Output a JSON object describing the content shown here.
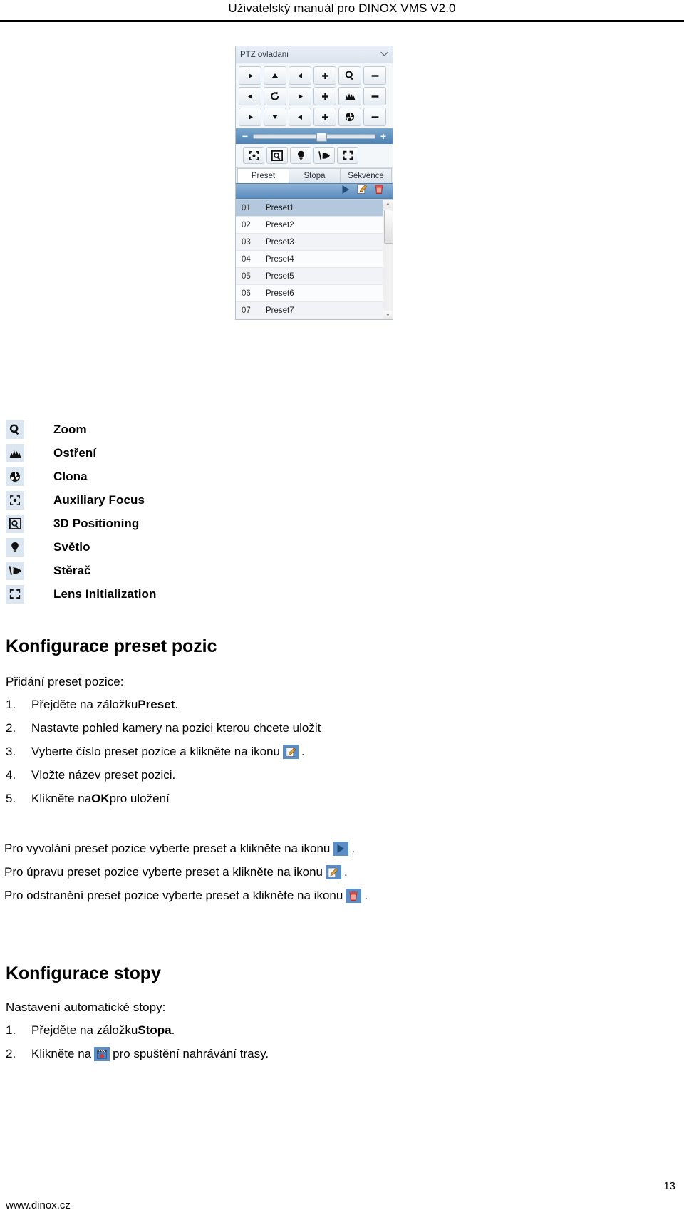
{
  "header": {
    "running_title": "Uživatelský manuál pro DINOX VMS V2.0"
  },
  "ptz_panel": {
    "title": "PTZ ovladani",
    "collapse_icon": "chevron-down-icon",
    "direction_rows": [
      {
        "buttons": [
          {
            "icon": "arrow-up-left-icon",
            "glyph": "▸"
          },
          {
            "icon": "arrow-up-icon",
            "glyph": "▲"
          },
          {
            "icon": "arrow-up-right-icon",
            "glyph": "◂"
          },
          {
            "icon": "zoom-plus-icon",
            "glyph": "+"
          },
          {
            "icon": "zoom-icon",
            "glyph": "zoom"
          },
          {
            "icon": "zoom-minus-icon",
            "glyph": "−"
          }
        ]
      },
      {
        "buttons": [
          {
            "icon": "arrow-left-icon",
            "glyph": "◀"
          },
          {
            "icon": "auto-scan-icon",
            "glyph": "↻"
          },
          {
            "icon": "arrow-right-icon",
            "glyph": "▶"
          },
          {
            "icon": "focus-plus-icon",
            "glyph": "+"
          },
          {
            "icon": "focus-icon",
            "glyph": "focus"
          },
          {
            "icon": "focus-minus-icon",
            "glyph": "−"
          }
        ]
      },
      {
        "buttons": [
          {
            "icon": "arrow-down-left-icon",
            "glyph": "▸"
          },
          {
            "icon": "arrow-down-icon",
            "glyph": "▼"
          },
          {
            "icon": "arrow-down-right-icon",
            "glyph": "◂"
          },
          {
            "icon": "iris-plus-icon",
            "glyph": "+"
          },
          {
            "icon": "iris-icon",
            "glyph": "iris"
          },
          {
            "icon": "iris-minus-icon",
            "glyph": "−"
          }
        ]
      }
    ],
    "speed_slider": {
      "minus_label": "−",
      "plus_label": "+",
      "value_percent": 52
    },
    "tools": [
      {
        "icon": "auxiliary-focus-icon"
      },
      {
        "icon": "3d-positioning-icon"
      },
      {
        "icon": "light-icon"
      },
      {
        "icon": "wiper-icon"
      },
      {
        "icon": "lens-initialization-icon"
      }
    ],
    "tabs": [
      {
        "label": "Preset",
        "active": true
      },
      {
        "label": "Stopa",
        "active": false
      },
      {
        "label": "Sekvence",
        "active": false
      }
    ],
    "action_bar": [
      {
        "icon": "play-icon"
      },
      {
        "icon": "edit-pencil-icon"
      },
      {
        "icon": "delete-trash-icon"
      }
    ],
    "presets": [
      {
        "index": "01",
        "name": "Preset1",
        "selected": true
      },
      {
        "index": "02",
        "name": "Preset2",
        "selected": false
      },
      {
        "index": "03",
        "name": "Preset3",
        "selected": false
      },
      {
        "index": "04",
        "name": "Preset4",
        "selected": false
      },
      {
        "index": "05",
        "name": "Preset5",
        "selected": false
      },
      {
        "index": "06",
        "name": "Preset6",
        "selected": false
      },
      {
        "index": "07",
        "name": "Preset7",
        "selected": false
      }
    ],
    "scrollbar": {
      "up_arrow": "▲",
      "down_arrow": "▼"
    }
  },
  "legend": [
    {
      "icon": "zoom-icon",
      "label": "Zoom"
    },
    {
      "icon": "focus-icon",
      "label": "Ostření"
    },
    {
      "icon": "iris-icon",
      "label": "Clona"
    },
    {
      "icon": "auxiliary-focus-icon",
      "label": "Auxiliary Focus"
    },
    {
      "icon": "3d-positioning-icon",
      "label": "3D Positioning"
    },
    {
      "icon": "light-icon",
      "label": "Světlo"
    },
    {
      "icon": "wiper-icon",
      "label": "Stěrač"
    },
    {
      "icon": "lens-initialization-icon",
      "label": "Lens Initialization"
    }
  ],
  "sections": {
    "presets": {
      "heading": "Konfigurace preset pozic",
      "intro": "Přidání preset pozice:",
      "steps": [
        {
          "num": "1.",
          "pre": "Přejděte na záložku ",
          "bold": "Preset",
          "post": ".",
          "icon": null
        },
        {
          "num": "2.",
          "pre": "Nastavte pohled kamery na pozici kterou chcete uložit",
          "bold": "",
          "post": "",
          "icon": null
        },
        {
          "num": "3.",
          "pre": "Vyberte číslo preset pozice a klikněte na ikonu ",
          "bold": "",
          "post": ".",
          "icon": "edit-pencil-icon"
        },
        {
          "num": "4.",
          "pre": "Vložte název preset pozici.",
          "bold": "",
          "post": "",
          "icon": null
        },
        {
          "num": "5.",
          "pre": "Klikněte na ",
          "bold": "OK",
          "post": " pro uložení",
          "icon": null
        }
      ],
      "notes": [
        {
          "pre": "Pro vyvolání preset pozice vyberte preset a klikněte na ikonu",
          "icon": "play-icon",
          "post": "."
        },
        {
          "pre": "Pro úpravu preset pozice vyberte preset a klikněte na ikonu",
          "icon": "edit-pencil-icon",
          "post": "."
        },
        {
          "pre": "Pro odstranění preset pozice vyberte preset a klikněte na ikonu",
          "icon": "delete-trash-icon",
          "post": "."
        }
      ]
    },
    "track": {
      "heading": "Konfigurace stopy",
      "intro": "Nastavení automatické stopy:",
      "steps": [
        {
          "num": "1.",
          "pre": "Přejděte na záložku ",
          "bold": "Stopa",
          "post": ".",
          "icon": null
        },
        {
          "num": "2.",
          "pre": "Klikněte na ",
          "bold": "",
          "post": " pro spuštění nahrávání trasy.",
          "icon": "record-track-icon"
        }
      ]
    }
  },
  "footer": {
    "url": "www.dinox.cz",
    "page_number": "13"
  },
  "colors": {
    "accent_blue": "#5b8ec6",
    "panel_bg": "#f4f7fa",
    "selection": "#b4c8dd",
    "chip_bg": "#dbe6f1"
  }
}
